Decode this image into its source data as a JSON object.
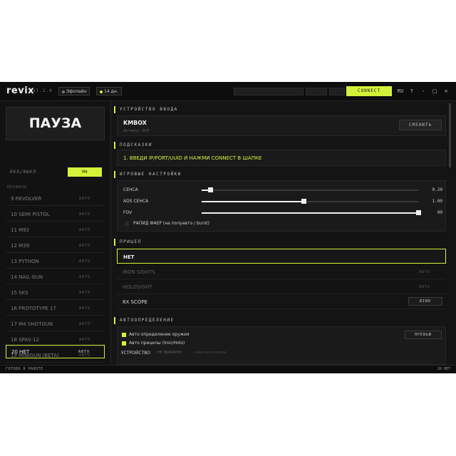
{
  "app": {
    "logo": "revix",
    "version": "V1.1.4"
  },
  "titlebar": {
    "mode_label": "Эфолайн",
    "days_label": "14 дн.",
    "connect_label": "CONNECT",
    "lang_label": "RU",
    "pin_label": "↑",
    "minimize_label": "-",
    "maximize_label": "□",
    "close_label": "×"
  },
  "sidebar": {
    "pause_label": "ПАУЗА",
    "toggle_label": "ВКЛ/ВЫКЛ",
    "toggle_key": "M4",
    "profiles_label": "ПРОФИЛИ",
    "profiles": [
      {
        "name": "9 REVOLVER",
        "state": "АВТО"
      },
      {
        "name": "10 SEMI PISTOL",
        "state": "АВТО"
      },
      {
        "name": "11 M92",
        "state": "АВТО"
      },
      {
        "name": "12 M39",
        "state": "АВТО"
      },
      {
        "name": "13 PYTHON",
        "state": "АВТО"
      },
      {
        "name": "14 NAIL GUN",
        "state": "АВТО"
      },
      {
        "name": "15 SKS",
        "state": "АВТО"
      },
      {
        "name": "16 PROTOTYPE 17",
        "state": "АВТО"
      },
      {
        "name": "17 M4 SHOTGUN",
        "state": "АВТО"
      },
      {
        "name": "18 SPAS-12",
        "state": "АВТО"
      },
      {
        "name": "19 MINIGUN (BETA)",
        "state": "АВТО"
      },
      {
        "name": "20 НЕТ",
        "state": "АВТО"
      }
    ]
  },
  "input_device": {
    "title": "УСТРОЙСТВО ВВОДА",
    "name": "KMBOX",
    "subtitle": "Активно · BUF",
    "change_label": "СМЕНИТЬ"
  },
  "hints": {
    "title": "ПОДСКАЗКИ",
    "text": "1. ВВЕДИ IP/PORT/UUID И НАЖМИ CONNECT В ШАПКЕ"
  },
  "game_settings": {
    "title": "ИГРОВЫЕ НАСТРОЙКИ",
    "sliders": [
      {
        "label": "СЕНСА",
        "value": "0.20",
        "fraction": 0.04
      },
      {
        "label": "ADS СЕНСА",
        "value": "1.00",
        "fraction": 0.47
      },
      {
        "label": "FOV",
        "value": "90",
        "fraction": 1.0
      }
    ],
    "rapid_fire_label": "РАПИД ФАЕР (на полуавто / burst)",
    "rapid_fire_checked": false
  },
  "scopes": {
    "title": "ПРИЦЕЛ",
    "items": [
      {
        "name": "НЕТ",
        "state": ""
      },
      {
        "name": "IRON SIGHTS",
        "state": "АВТО"
      },
      {
        "name": "HOLOSIGHT",
        "state": "АВТО"
      },
      {
        "name": "8X SCOPE",
        "state": "BIND"
      }
    ]
  },
  "autodetect": {
    "title": "АВТООПРЕДЕЛЕНИЕ",
    "weapon_label": "Авто определение оружия",
    "scope_label": "Авто прицелы (Iron/Holo)",
    "preview_label": "ПРЕВЬЮ",
    "device_label": "УСТРОЙСТВО",
    "device_value": "НЕ ВЫБРАНО",
    "device_hint": "· нажм для списка"
  },
  "status": {
    "left": "ГОТОВО К РАБОТЕ",
    "right": "20 НЕТ"
  },
  "colors": {
    "accent": "#d4f23a",
    "background": "#141414",
    "panel": "#1a1a1a"
  }
}
